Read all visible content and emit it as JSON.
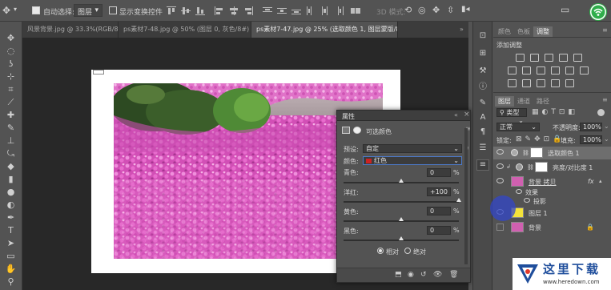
{
  "options_bar": {
    "auto_select_label": "自动选择:",
    "auto_select_value": "图层",
    "show_transform_label": "显示变换控件",
    "mode_3d_label": "3D 模式:"
  },
  "doc_tabs": [
    {
      "label": "风景背景.jpg @ 33.3%(RGB/8#)"
    },
    {
      "label": "ps素材7-48.jpg @ 50% (图层 0, 灰色/8#) *"
    },
    {
      "label": "ps素材7-47.jpg @ 25% (选取颜色 1, 图层蒙版/8) *"
    }
  ],
  "properties": {
    "title": "属性",
    "sub_title": "可选颜色",
    "preset_label": "预设:",
    "preset_value": "自定",
    "colors_label": "颜色:",
    "colors_value": "红色",
    "colors_swatch": "#cc2222",
    "sliders": [
      {
        "label": "青色:",
        "value": "0",
        "unit": "%",
        "level": 0
      },
      {
        "label": "洋红:",
        "value": "+100",
        "unit": "%",
        "level": 100
      },
      {
        "label": "黄色:",
        "value": "0",
        "unit": "%",
        "level": 0
      },
      {
        "label": "黑色:",
        "value": "0",
        "unit": "%",
        "level": 0
      }
    ],
    "method_relative": "相对",
    "method_absolute": "绝对",
    "method_selected": "relative"
  },
  "right_panel": {
    "top_tabs": [
      "颜色",
      "色板",
      "调整"
    ],
    "adjust_title": "添加调整",
    "layer_tabs": [
      "图层",
      "通道",
      "路径"
    ],
    "kind_label": "类型",
    "blend_mode": "正常",
    "opacity_label": "不透明度:",
    "opacity_value": "100%",
    "lock_label": "锁定:",
    "fill_label": "填充:",
    "fill_value": "100%",
    "layers": [
      {
        "name": "选取颜色 1",
        "thumb_color": "#ffffff"
      },
      {
        "name": "亮度/对比度 1",
        "thumb_color": "#ffffff"
      },
      {
        "name": "背景 拷贝",
        "thumb_color": "#d060b0",
        "fx": "fx"
      },
      {
        "name": "效果",
        "kind": "effects"
      },
      {
        "name": "投影",
        "kind": "effect"
      },
      {
        "name": "图层 1",
        "thumb_color": "#f4e33a"
      },
      {
        "name": "背景",
        "thumb_color": "#d060b0"
      }
    ]
  },
  "watermark": {
    "title": "这里下载",
    "url": "www.heredown.com"
  },
  "colors": {
    "panel": "#535353",
    "dark": "#282828",
    "accent": "#4c79c8"
  }
}
